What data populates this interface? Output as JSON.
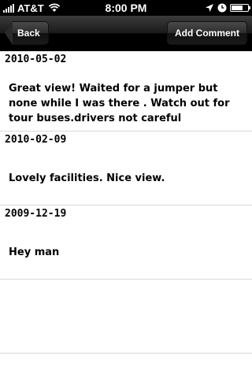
{
  "status_bar": {
    "carrier": "AT&T",
    "time": "8:00 PM",
    "signal_icon": "signal-bars-icon",
    "wifi_icon": "wifi-icon",
    "location_icon": "location-arrow-icon",
    "alarm_icon": "clock-icon",
    "battery_icon": "battery-icon",
    "battery_level": 0.7
  },
  "nav_bar": {
    "back_label": "Back",
    "add_comment_label": "Add Comment"
  },
  "comments": [
    {
      "date": "2010-05-02",
      "text": "Great view! Waited for a jumper but none while I was there . Watch out for tour buses.drivers not careful"
    },
    {
      "date": "2010-02-09",
      "text": "Lovely facilities. Nice view."
    },
    {
      "date": "2009-12-19",
      "text": "Hey man"
    }
  ],
  "colors": {
    "nav_bar": "#000000",
    "separator": "#d9d9d9",
    "background": "#ffffff"
  }
}
